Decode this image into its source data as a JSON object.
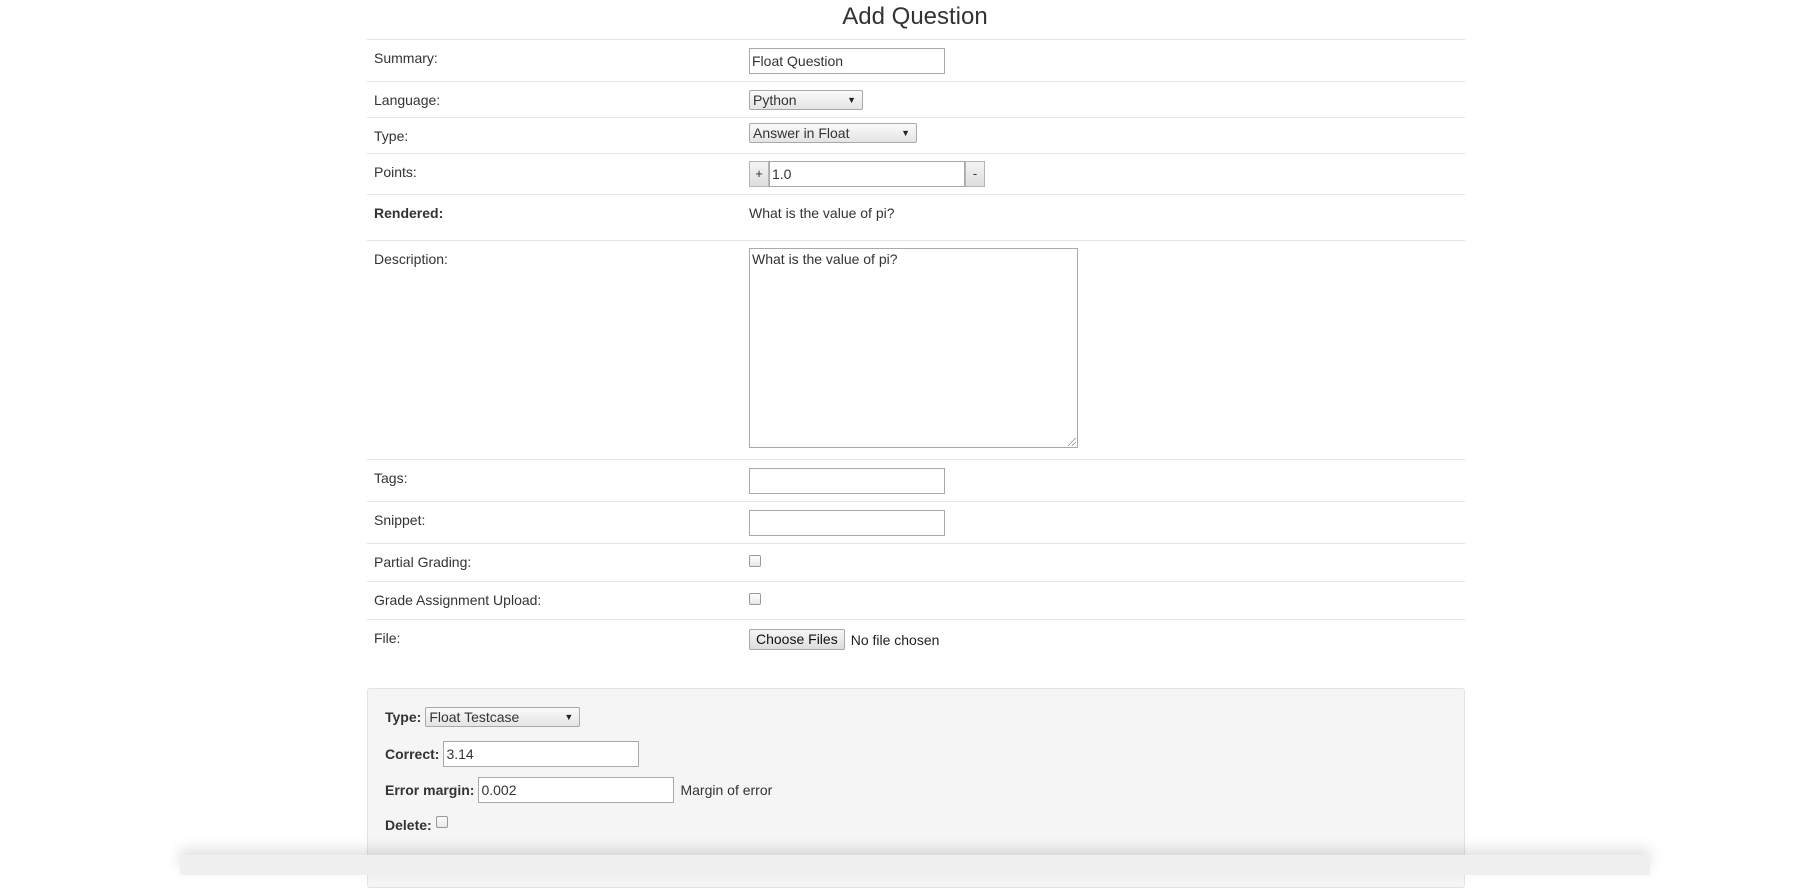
{
  "page": {
    "title": "Add Question"
  },
  "form": {
    "summary": {
      "label": "Summary:",
      "value": "Float Question"
    },
    "language": {
      "label": "Language:",
      "selected": "Python"
    },
    "type": {
      "label": "Type:",
      "selected": "Answer in Float"
    },
    "points": {
      "label": "Points:",
      "value": "1.0",
      "plus": "+",
      "minus": "-"
    },
    "rendered": {
      "label": "Rendered:",
      "text": "What is the value of pi?"
    },
    "description": {
      "label": "Description:",
      "value": "What is the value of pi?"
    },
    "tags": {
      "label": "Tags:",
      "value": ""
    },
    "snippet": {
      "label": "Snippet:",
      "value": ""
    },
    "partial_grading": {
      "label": "Partial Grading:",
      "checked": false
    },
    "grade_assignment_upload": {
      "label": "Grade Assignment Upload:",
      "checked": false
    },
    "file": {
      "label": "File:",
      "button": "Choose Files",
      "status": "No file chosen"
    }
  },
  "testcase": {
    "type_label": "Type:",
    "type_selected": "Float Testcase",
    "correct_label": "Correct:",
    "correct_value": "3.14",
    "error_margin_label": "Error margin:",
    "error_margin_value": "0.002",
    "error_margin_note": "Margin of error",
    "delete_label": "Delete:",
    "delete_checked": false
  },
  "icons": {
    "dropdown": "caret-down-icon",
    "resize": "resize-grip-icon"
  }
}
